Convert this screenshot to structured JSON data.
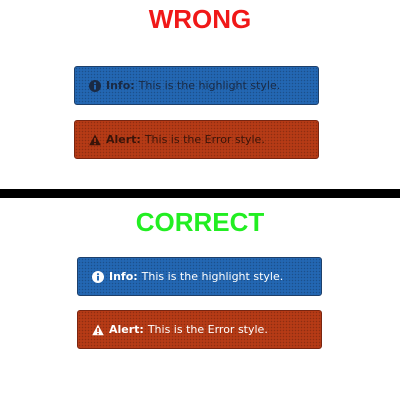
{
  "sections": {
    "wrong": {
      "heading": "WRONG",
      "info": {
        "icon": "info-circle-icon",
        "label": "Info:",
        "text": "This is the highlight style."
      },
      "alert": {
        "icon": "warning-triangle-icon",
        "label": "Alert:",
        "text": "This is the Error style."
      }
    },
    "correct": {
      "heading": "CORRECT",
      "info": {
        "icon": "info-circle-icon",
        "label": "Info:",
        "text": "This is the highlight style."
      },
      "alert": {
        "icon": "warning-triangle-icon",
        "label": "Alert:",
        "text": "This is the Error style."
      }
    }
  },
  "colors": {
    "wrong_heading": "#f01818",
    "correct_heading": "#22ee22",
    "info_background": "#2367b3",
    "alert_background": "#b63b16",
    "divider": "#000000"
  }
}
